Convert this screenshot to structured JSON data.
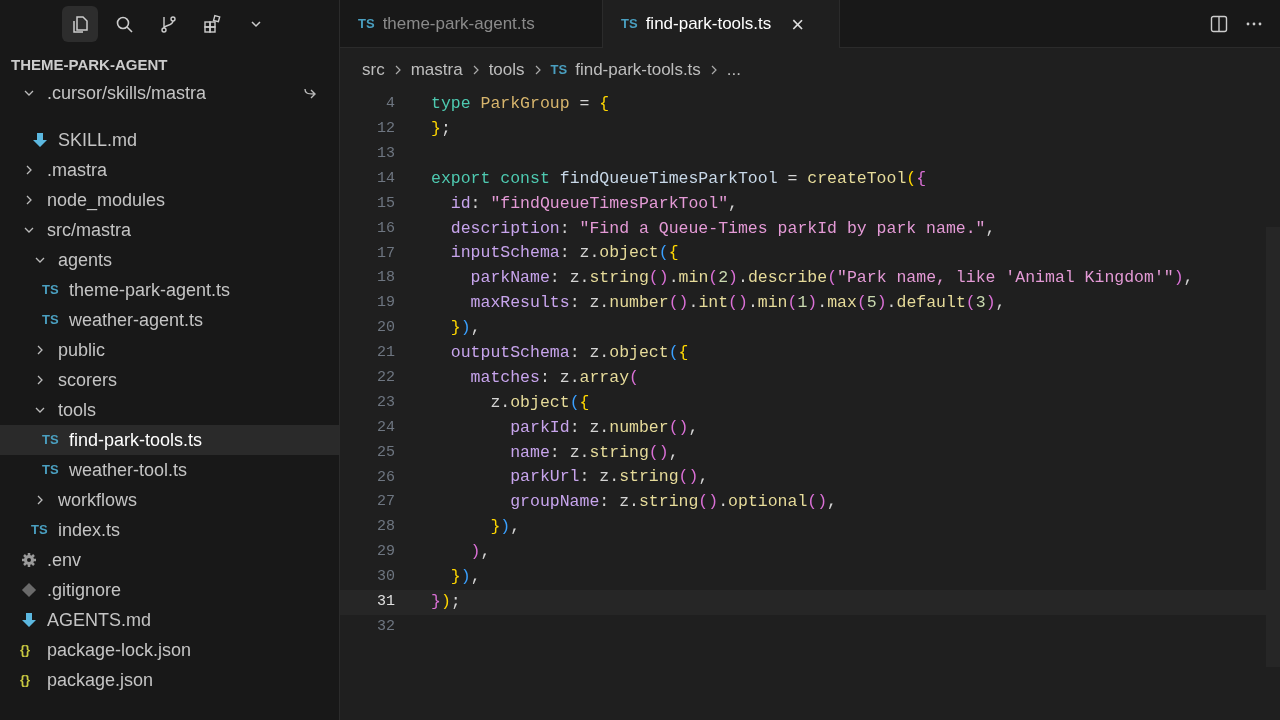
{
  "activity_bar": {
    "items": [
      {
        "kind": "files",
        "selected": true
      },
      {
        "kind": "search",
        "selected": false
      },
      {
        "kind": "source-control",
        "selected": false
      },
      {
        "kind": "extensions",
        "selected": false
      },
      {
        "kind": "more",
        "selected": false
      }
    ]
  },
  "explorer": {
    "title": "THEME-PARK-AGENT",
    "tree": [
      {
        "label": ".cursor/skills/mastra",
        "kind": "folder",
        "expanded": true,
        "pinned": true,
        "children": [
          {
            "label": "SKILL.md",
            "kind": "md",
            "selected": false
          }
        ]
      },
      {
        "label": ".mastra",
        "kind": "folder",
        "expanded": false
      },
      {
        "label": "node_modules",
        "kind": "folder",
        "expanded": false
      },
      {
        "label": "src/mastra",
        "kind": "folder",
        "expanded": true,
        "children": [
          {
            "label": "agents",
            "kind": "folder",
            "expanded": true,
            "children": [
              {
                "label": "theme-park-agent.ts",
                "kind": "ts",
                "badge": "TS",
                "selected": false
              },
              {
                "label": "weather-agent.ts",
                "kind": "ts",
                "badge": "TS",
                "selected": false
              }
            ]
          },
          {
            "label": "public",
            "kind": "folder",
            "expanded": false
          },
          {
            "label": "scorers",
            "kind": "folder",
            "expanded": false
          },
          {
            "label": "tools",
            "kind": "folder",
            "expanded": true,
            "children": [
              {
                "label": "find-park-tools.ts",
                "kind": "ts",
                "badge": "TS",
                "selected": true
              },
              {
                "label": "weather-tool.ts",
                "kind": "ts",
                "badge": "TS",
                "selected": false
              }
            ]
          },
          {
            "label": "workflows",
            "kind": "folder",
            "expanded": false
          },
          {
            "label": "index.ts",
            "kind": "ts",
            "badge": "TS",
            "selected": false
          }
        ]
      },
      {
        "label": ".env",
        "kind": "gear",
        "selected": false
      },
      {
        "label": ".gitignore",
        "kind": "git",
        "selected": false
      },
      {
        "label": "AGENTS.md",
        "kind": "md",
        "selected": false
      },
      {
        "label": "package-lock.json",
        "kind": "json",
        "badge": "{}",
        "selected": false
      },
      {
        "label": "package.json",
        "kind": "json",
        "badge": "{}",
        "selected": false
      }
    ]
  },
  "tabs": [
    {
      "badge": "TS",
      "label": "theme-park-agent.ts",
      "selected": false
    },
    {
      "badge": "TS",
      "label": "find-park-tools.ts",
      "selected": true,
      "close": "×"
    }
  ],
  "breadcrumbs": [
    {
      "label": "src"
    },
    {
      "label": "mastra"
    },
    {
      "label": "tools"
    },
    {
      "label": "find-park-tools.ts",
      "badge": "TS"
    },
    {
      "label": "..."
    }
  ],
  "editor": {
    "lines": [
      {
        "number": "4",
        "current": false,
        "tokens": [
          {
            "text": "type",
            "kind": "kw"
          },
          {
            "text": " ParkGroup",
            "kind": "type"
          },
          {
            "text": " =",
            "kind": "p"
          },
          {
            "text": " {",
            "kind": "b1"
          }
        ]
      },
      {
        "number": "12",
        "current": false,
        "tokens": [
          {
            "text": "}",
            "kind": "b1"
          },
          {
            "text": ";",
            "kind": "p"
          }
        ]
      },
      {
        "number": "13",
        "current": false
      },
      {
        "number": "14",
        "current": false,
        "tokens": [
          {
            "text": "export const",
            "kind": "kw"
          },
          {
            "text": " findQueueTimesParkTool",
            "kind": "var"
          },
          {
            "text": " =",
            "kind": "p"
          },
          {
            "text": " createTool",
            "kind": "fn"
          },
          {
            "text": "(",
            "kind": "b1"
          },
          {
            "text": "{",
            "kind": "b2"
          }
        ]
      },
      {
        "number": "15",
        "current": false,
        "tokens": [
          {
            "text": "  id",
            "kind": "prop"
          },
          {
            "text": ":",
            "kind": "p"
          },
          {
            "text": " \"findQueueTimesParkTool\"",
            "kind": "str"
          },
          {
            "text": ",",
            "kind": "p"
          }
        ]
      },
      {
        "number": "16",
        "current": false,
        "tokens": [
          {
            "text": "  description",
            "kind": "prop"
          },
          {
            "text": ":",
            "kind": "p"
          },
          {
            "text": " \"Find a Queue-Times parkId by park name.\"",
            "kind": "str"
          },
          {
            "text": ",",
            "kind": "p"
          }
        ]
      },
      {
        "number": "17",
        "current": false,
        "tokens": [
          {
            "text": "  inputSchema",
            "kind": "prop"
          },
          {
            "text": ": z.",
            "kind": "p"
          },
          {
            "text": "object",
            "kind": "fn"
          },
          {
            "text": "(",
            "kind": "b3"
          },
          {
            "text": "{",
            "kind": "b1"
          }
        ]
      },
      {
        "number": "18",
        "current": false,
        "tokens": [
          {
            "text": "    parkName",
            "kind": "prop"
          },
          {
            "text": ": z.",
            "kind": "p"
          },
          {
            "text": "string",
            "kind": "fn"
          },
          {
            "text": "()",
            "kind": "b2"
          },
          {
            "text": ".",
            "kind": "p"
          },
          {
            "text": "min",
            "kind": "fn"
          },
          {
            "text": "(",
            "kind": "b2"
          },
          {
            "text": "2",
            "kind": "num"
          },
          {
            "text": ")",
            "kind": "b2"
          },
          {
            "text": ".",
            "kind": "p"
          },
          {
            "text": "describe",
            "kind": "fn"
          },
          {
            "text": "(",
            "kind": "b2"
          },
          {
            "text": "\"Park name, like 'Animal Kingdom'\"",
            "kind": "str"
          },
          {
            "text": ")",
            "kind": "b2"
          },
          {
            "text": ",",
            "kind": "p"
          }
        ]
      },
      {
        "number": "19",
        "current": false,
        "tokens": [
          {
            "text": "    maxResults",
            "kind": "prop"
          },
          {
            "text": ": z.",
            "kind": "p"
          },
          {
            "text": "number",
            "kind": "fn"
          },
          {
            "text": "()",
            "kind": "b2"
          },
          {
            "text": ".",
            "kind": "p"
          },
          {
            "text": "int",
            "kind": "fn"
          },
          {
            "text": "()",
            "kind": "b2"
          },
          {
            "text": ".",
            "kind": "p"
          },
          {
            "text": "min",
            "kind": "fn"
          },
          {
            "text": "(",
            "kind": "b2"
          },
          {
            "text": "1",
            "kind": "num"
          },
          {
            "text": ")",
            "kind": "b2"
          },
          {
            "text": ".",
            "kind": "p"
          },
          {
            "text": "max",
            "kind": "fn"
          },
          {
            "text": "(",
            "kind": "b2"
          },
          {
            "text": "5",
            "kind": "num"
          },
          {
            "text": ")",
            "kind": "b2"
          },
          {
            "text": ".",
            "kind": "p"
          },
          {
            "text": "default",
            "kind": "fn"
          },
          {
            "text": "(",
            "kind": "b2"
          },
          {
            "text": "3",
            "kind": "num"
          },
          {
            "text": ")",
            "kind": "b2"
          },
          {
            "text": ",",
            "kind": "p"
          }
        ]
      },
      {
        "number": "20",
        "current": false,
        "tokens": [
          {
            "text": "  }",
            "kind": "b1"
          },
          {
            "text": ")",
            "kind": "b3"
          },
          {
            "text": ",",
            "kind": "p"
          }
        ]
      },
      {
        "number": "21",
        "current": false,
        "tokens": [
          {
            "text": "  outputSchema",
            "kind": "prop"
          },
          {
            "text": ": z.",
            "kind": "p"
          },
          {
            "text": "object",
            "kind": "fn"
          },
          {
            "text": "(",
            "kind": "b3"
          },
          {
            "text": "{",
            "kind": "b1"
          }
        ]
      },
      {
        "number": "22",
        "current": false,
        "tokens": [
          {
            "text": "    matches",
            "kind": "prop"
          },
          {
            "text": ": z.",
            "kind": "p"
          },
          {
            "text": "array",
            "kind": "fn"
          },
          {
            "text": "(",
            "kind": "b2"
          }
        ]
      },
      {
        "number": "23",
        "current": false,
        "tokens": [
          {
            "text": "      z.",
            "kind": "p"
          },
          {
            "text": "object",
            "kind": "fn"
          },
          {
            "text": "(",
            "kind": "b3"
          },
          {
            "text": "{",
            "kind": "b1"
          }
        ]
      },
      {
        "number": "24",
        "current": false,
        "tokens": [
          {
            "text": "        parkId",
            "kind": "prop"
          },
          {
            "text": ": z.",
            "kind": "p"
          },
          {
            "text": "number",
            "kind": "fn"
          },
          {
            "text": "()",
            "kind": "b2"
          },
          {
            "text": ",",
            "kind": "p"
          }
        ]
      },
      {
        "number": "25",
        "current": false,
        "tokens": [
          {
            "text": "        name",
            "kind": "prop"
          },
          {
            "text": ": z.",
            "kind": "p"
          },
          {
            "text": "string",
            "kind": "fn"
          },
          {
            "text": "()",
            "kind": "b2"
          },
          {
            "text": ",",
            "kind": "p"
          }
        ]
      },
      {
        "number": "26",
        "current": false,
        "tokens": [
          {
            "text": "        parkUrl",
            "kind": "prop"
          },
          {
            "text": ": z.",
            "kind": "p"
          },
          {
            "text": "string",
            "kind": "fn"
          },
          {
            "text": "()",
            "kind": "b2"
          },
          {
            "text": ",",
            "kind": "p"
          }
        ]
      },
      {
        "number": "27",
        "current": false,
        "tokens": [
          {
            "text": "        groupName",
            "kind": "prop"
          },
          {
            "text": ": z.",
            "kind": "p"
          },
          {
            "text": "string",
            "kind": "fn"
          },
          {
            "text": "()",
            "kind": "b2"
          },
          {
            "text": ".",
            "kind": "p"
          },
          {
            "text": "optional",
            "kind": "fn"
          },
          {
            "text": "()",
            "kind": "b2"
          },
          {
            "text": ",",
            "kind": "p"
          }
        ]
      },
      {
        "number": "28",
        "current": false,
        "tokens": [
          {
            "text": "      }",
            "kind": "b1"
          },
          {
            "text": ")",
            "kind": "b3"
          },
          {
            "text": ",",
            "kind": "p"
          }
        ]
      },
      {
        "number": "29",
        "current": false,
        "tokens": [
          {
            "text": "    )",
            "kind": "b2"
          },
          {
            "text": ",",
            "kind": "p"
          }
        ]
      },
      {
        "number": "30",
        "current": false,
        "tokens": [
          {
            "text": "  }",
            "kind": "b1"
          },
          {
            "text": ")",
            "kind": "b3"
          },
          {
            "text": ",",
            "kind": "p"
          }
        ]
      },
      {
        "number": "31",
        "current": true,
        "tokens": [
          {
            "text": "}",
            "kind": "b2"
          },
          {
            "text": ")",
            "kind": "b1"
          },
          {
            "text": ";",
            "kind": "p"
          }
        ]
      },
      {
        "number": "32",
        "current": false
      }
    ]
  }
}
